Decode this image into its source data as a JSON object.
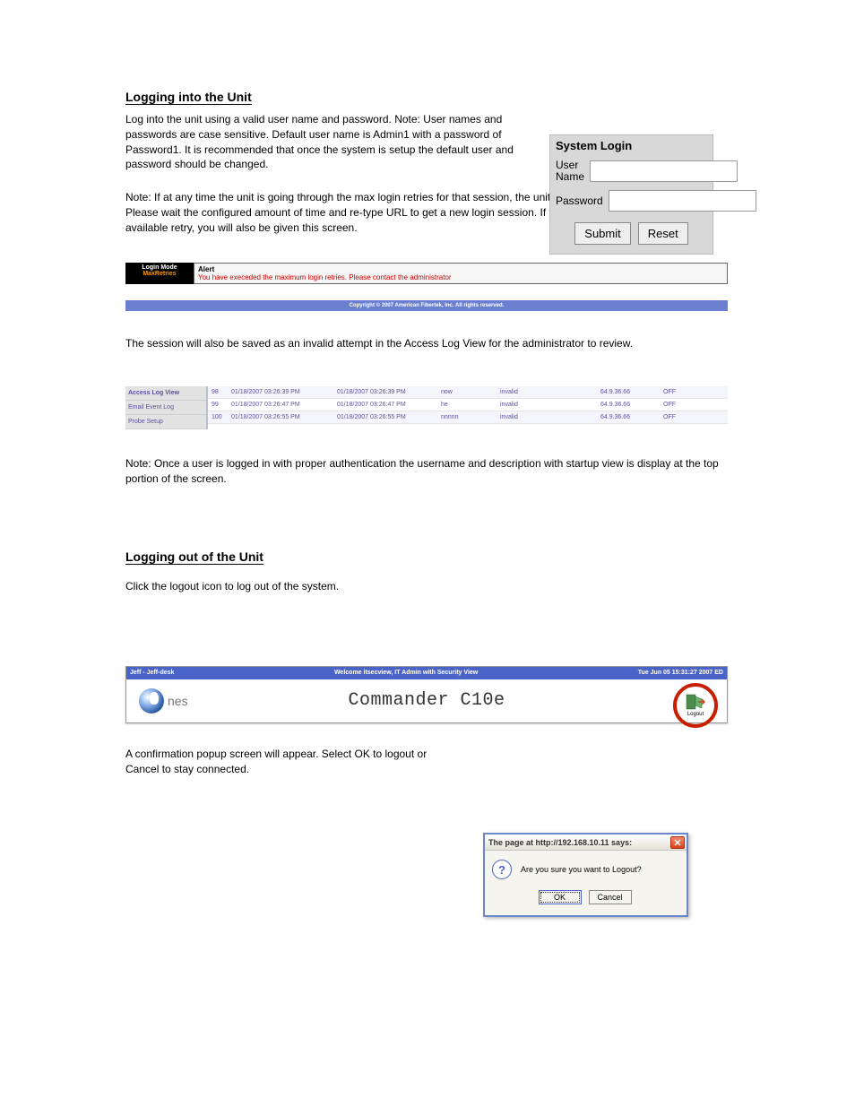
{
  "section_login": {
    "title": "Logging into the Unit",
    "para": "Log into the unit using a valid user name and password. Note: User names and passwords are case sensitive. Default user name is Admin1 with a password of Password1. It is recommended that once the system is setup the default user and password should be changed."
  },
  "login_panel": {
    "title": "System Login",
    "user_label": "User Name",
    "pass_label": "Password",
    "user_value": "",
    "pass_value": "",
    "submit": "Submit",
    "reset": "Reset"
  },
  "note_max_retries": "Note: If at any time the unit is going through the max login retries for that session, the unit will display the following screen. Please wait the configured amount of time and re-type URL to get a new login session. If you login incorrectly on the last available retry, you will also be given this screen.",
  "alert_bar": {
    "login_mode": "Login Mode",
    "max": "MaxRetries",
    "alert_label": "Alert",
    "alert_msg": "You have execeded the maximum login retries. Please contact the administrator",
    "copyright": "Copyright © 2007 American Fibertek, Inc. All rights reserved."
  },
  "para_session_log": "The session will also be saved as an invalid attempt in the Access Log View for the administrator to review.",
  "log_nav": {
    "a": "Access Log View",
    "b": "Email Event Log",
    "c": "Probe Setup"
  },
  "log_rows": [
    {
      "id": "98",
      "d1": "01/18/2007 03:26:39 PM",
      "d2": "01/18/2007 03:26:39 PM",
      "user": "now",
      "stat": "invalid",
      "ip": "64.9.36.66",
      "off": "OFF"
    },
    {
      "id": "99",
      "d1": "01/18/2007 03:26:47 PM",
      "d2": "01/18/2007 03:26:47 PM",
      "user": "he",
      "stat": "invalid",
      "ip": "64.9.36.66",
      "off": "OFF"
    },
    {
      "id": "100",
      "d1": "01/18/2007 03:26:55 PM",
      "d2": "01/18/2007 03:26:55 PM",
      "user": "nnnnn",
      "stat": "invalid",
      "ip": "64.9.36.66",
      "off": "OFF"
    }
  ],
  "note_welcome": "Note: Once a user is logged in with proper authentication the username and description with startup view is display at the top portion of the screen.",
  "section_logout": {
    "title": "Logging out of the Unit",
    "para": "Click the logout icon to log out of the system."
  },
  "cmdr": {
    "left": "Jeff - Jeff-desk",
    "center": "Welcome itsecview, IT Admin with Security View",
    "right": "Tue Jun 05 15:31:27 2007 ED",
    "logo_txt": "nes",
    "title": "Commander C10e",
    "logout_label": "Logout"
  },
  "dialog_caption": "A confirmation popup screen will appear. Select OK to logout or Cancel to stay connected.",
  "dialog": {
    "title": "The page at http://192.168.10.11 says:",
    "msg": "Are you sure you want to Logout?",
    "ok": "OK",
    "cancel": "Cancel"
  }
}
